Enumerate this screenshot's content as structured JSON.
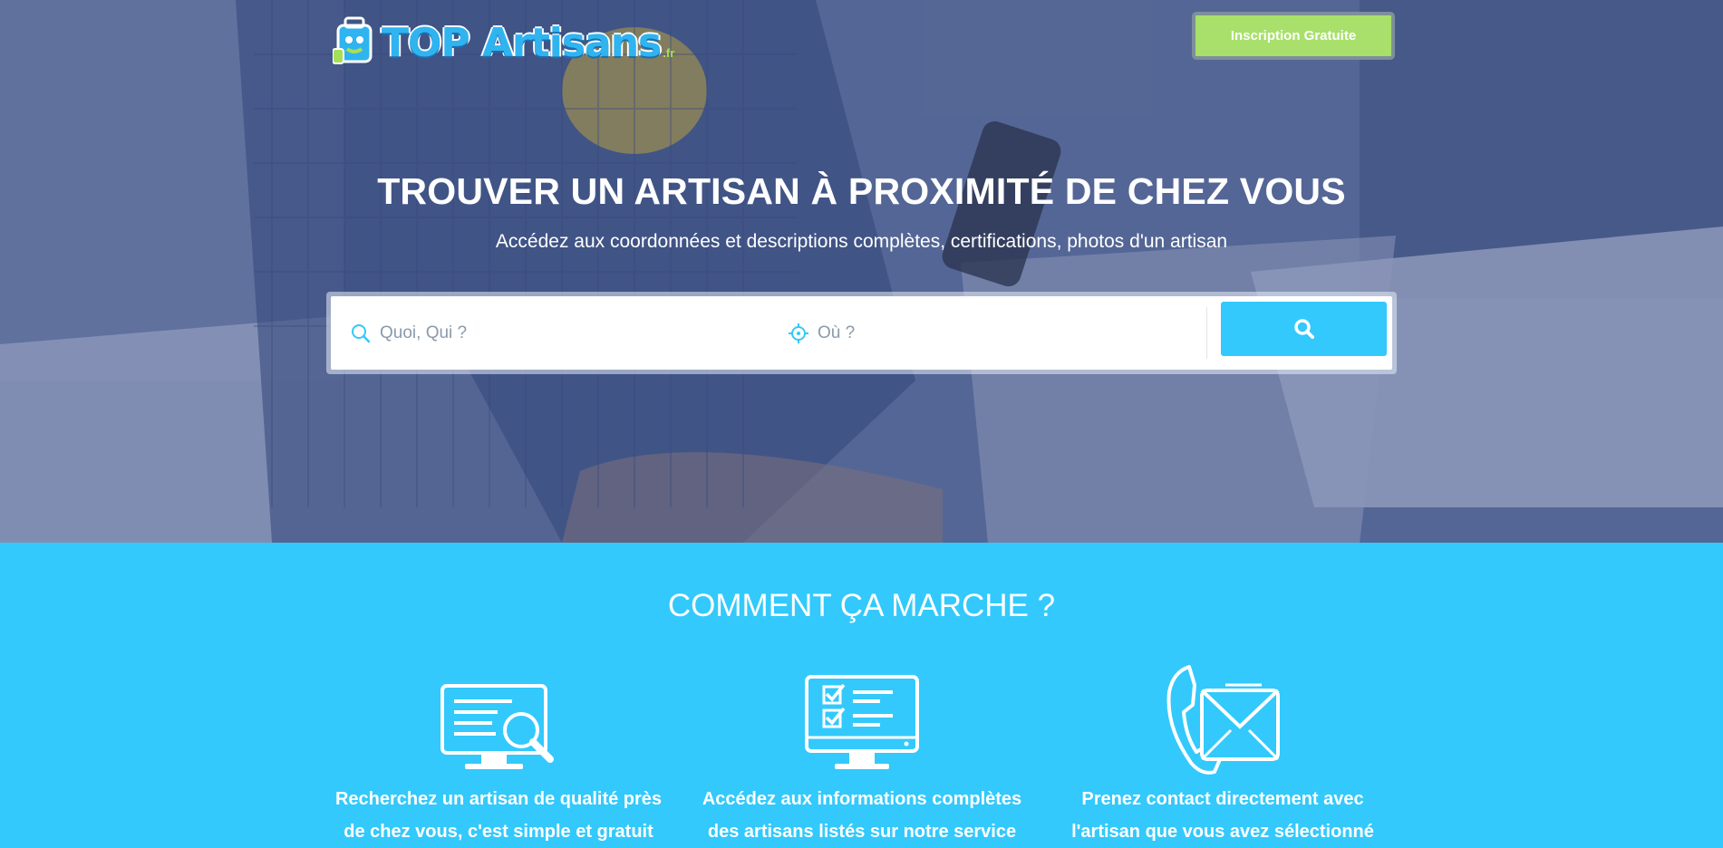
{
  "header": {
    "logo_text": "TOP Artisans",
    "logo_tld": ".fr",
    "signup_label": "Inscription Gratuite"
  },
  "hero": {
    "title": "TROUVER UN ARTISAN À PROXIMITÉ DE CHEZ VOUS",
    "subtitle": "Accédez aux coordonnées et descriptions complètes, certifications, photos d'un artisan"
  },
  "search": {
    "what_placeholder": "Quoi, Qui ?",
    "where_placeholder": "Où ?",
    "what_icon": "search-icon",
    "where_icon": "crosshair-icon",
    "button_icon": "search-icon"
  },
  "how": {
    "title": "COMMENT ÇA MARCHE ?",
    "steps": [
      {
        "icon": "computer-search-icon",
        "line1": "Recherchez un artisan de qualité près",
        "line2": "de chez vous, c'est simple et gratuit"
      },
      {
        "icon": "checklist-monitor-icon",
        "line1": "Accédez aux informations complètes",
        "line2": "des artisans listés sur notre service"
      },
      {
        "icon": "phone-mail-icon",
        "line1": "Prenez contact directement avec",
        "line2": "l'artisan que vous avez sélectionné"
      }
    ]
  },
  "colors": {
    "accent": "#33c9fc",
    "signup": "#a8e06b",
    "hero_overlay": "#4f6189"
  }
}
